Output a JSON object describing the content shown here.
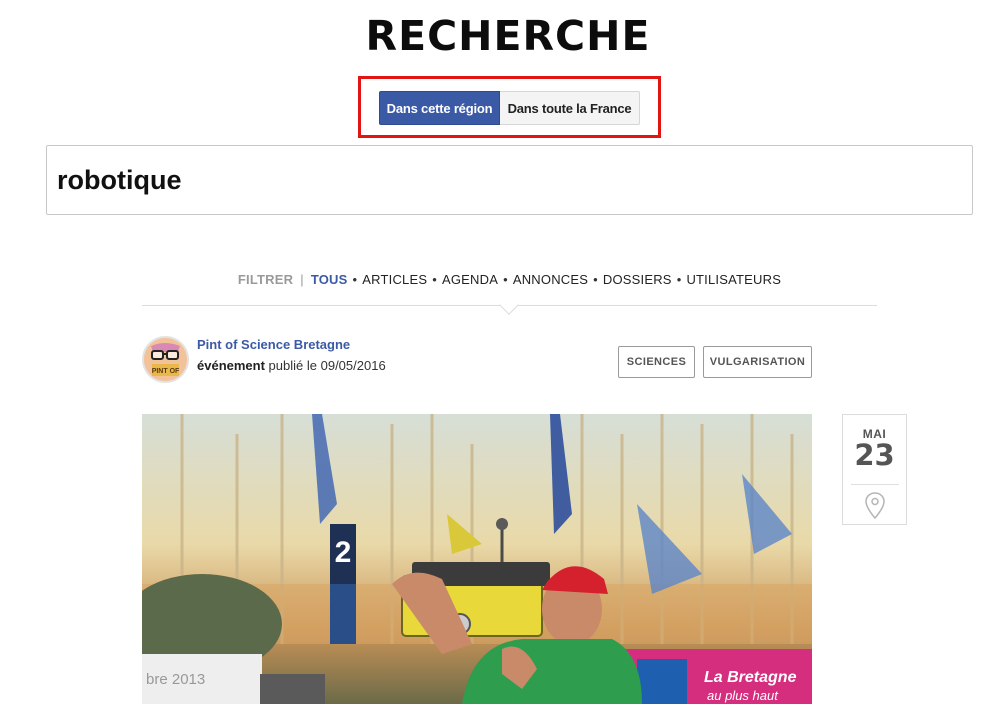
{
  "page": {
    "title": "RECHERCHE"
  },
  "scope": {
    "active_label": "Dans cette région",
    "other_label": "Dans toute la France"
  },
  "search": {
    "query": "robotique"
  },
  "filters": {
    "label": "FILTRER",
    "items": [
      {
        "label": "TOUS",
        "active": true
      },
      {
        "label": "ARTICLES",
        "active": false
      },
      {
        "label": "AGENDA",
        "active": false
      },
      {
        "label": "ANNONCES",
        "active": false
      },
      {
        "label": "DOSSIERS",
        "active": false
      },
      {
        "label": "UTILISATEURS",
        "active": false
      }
    ]
  },
  "result": {
    "author": "Pint of Science Bretagne",
    "avatar_text": "PINT OF",
    "type": "événement",
    "published_prefix": "publié le",
    "date": "09/05/2016",
    "tags": [
      "SCIENCES",
      "VULGARISATION"
    ],
    "event_month": "MAI",
    "event_day": "23",
    "photo_caption_fragment": "bre 2013",
    "photo_banner_text": "La Bretagne",
    "photo_banner_sub": "au plus haut",
    "photo_sign": "2"
  },
  "colors": {
    "accent": "#3b5aa6",
    "highlight_border": "#e31414",
    "tag_border": "#9a9a9a"
  },
  "icons": {
    "location": "map-pin-icon"
  }
}
